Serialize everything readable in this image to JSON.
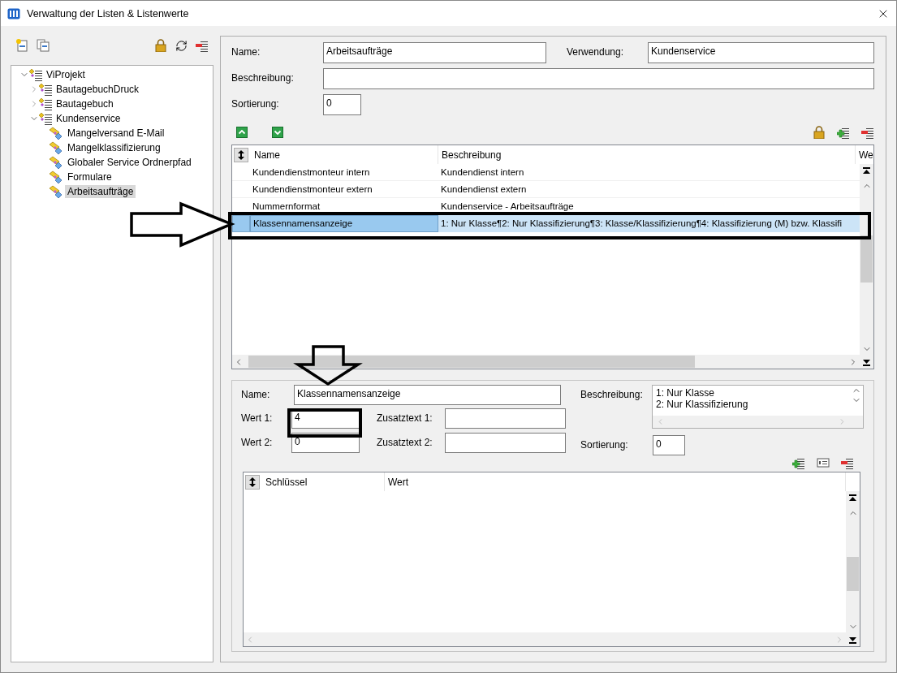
{
  "window": {
    "title": "Verwaltung der Listen & Listenwerte"
  },
  "tree": [
    {
      "label": "ViProjekt",
      "kind": "group",
      "expanded": true,
      "selected": false,
      "children": [
        {
          "label": "BautagebuchDruck",
          "kind": "group",
          "expanded": false,
          "selected": false
        },
        {
          "label": "Bautagebuch",
          "kind": "group",
          "expanded": false,
          "selected": false
        },
        {
          "label": "Kundenservice",
          "kind": "group",
          "expanded": true,
          "selected": false,
          "children": [
            {
              "label": "Mangelversand E-Mail",
              "kind": "list",
              "selected": false
            },
            {
              "label": "Mangelklassifizierung",
              "kind": "list",
              "selected": false
            },
            {
              "label": "Globaler Service Ordnerpfad",
              "kind": "list",
              "selected": false
            },
            {
              "label": "Formulare",
              "kind": "list",
              "selected": false
            },
            {
              "label": "Arbeitsaufträge",
              "kind": "list",
              "selected": true
            }
          ]
        }
      ]
    }
  ],
  "list_form": {
    "name": {
      "label": "Name:",
      "value": "Arbeitsaufträge"
    },
    "usage": {
      "label": "Verwendung:",
      "value": "Kundenservice"
    },
    "description": {
      "label": "Beschreibung:"
    },
    "sort_order": {
      "label": "Sortierung:",
      "value": "0"
    }
  },
  "values_table": {
    "columns": [
      "Name",
      "Beschreibung",
      "We"
    ],
    "rows": [
      {
        "cells": [
          "Kundendienstmonteur intern",
          "Kundendienst intern"
        ],
        "selected": false
      },
      {
        "cells": [
          "Kundendienstmonteur extern",
          "Kundendienst extern"
        ],
        "selected": false
      },
      {
        "cells": [
          "Nummernformat",
          "Kundenservice - Arbeitsaufträge"
        ],
        "selected": false
      },
      {
        "cells": [
          "Klassennamensanzeige",
          "1: Nur Klasse¶2: Nur Klassifizierung¶3: Klasse/Klassifizierung¶4: Klassifizierung (M) bzw. Klassifi"
        ],
        "selected": true
      }
    ]
  },
  "value_form": {
    "name": {
      "label": "Name:",
      "value": "Klassennamensanzeige"
    },
    "value_1": {
      "label": "Wert 1:",
      "value": "4"
    },
    "value_2": {
      "label": "Wert 2:",
      "value": "0"
    },
    "extra_text_1": {
      "label": "Zusatztext 1:"
    },
    "extra_text_2": {
      "label": "Zusatztext 2:"
    },
    "description": {
      "label": "Beschreibung:",
      "lines": [
        "1: Nur Klasse",
        "2: Nur Klassifizierung"
      ]
    },
    "sort_order": {
      "label": "Sortierung:",
      "value": "0"
    }
  },
  "keys_table": {
    "columns": [
      "Schlüssel",
      "Wert"
    ]
  }
}
